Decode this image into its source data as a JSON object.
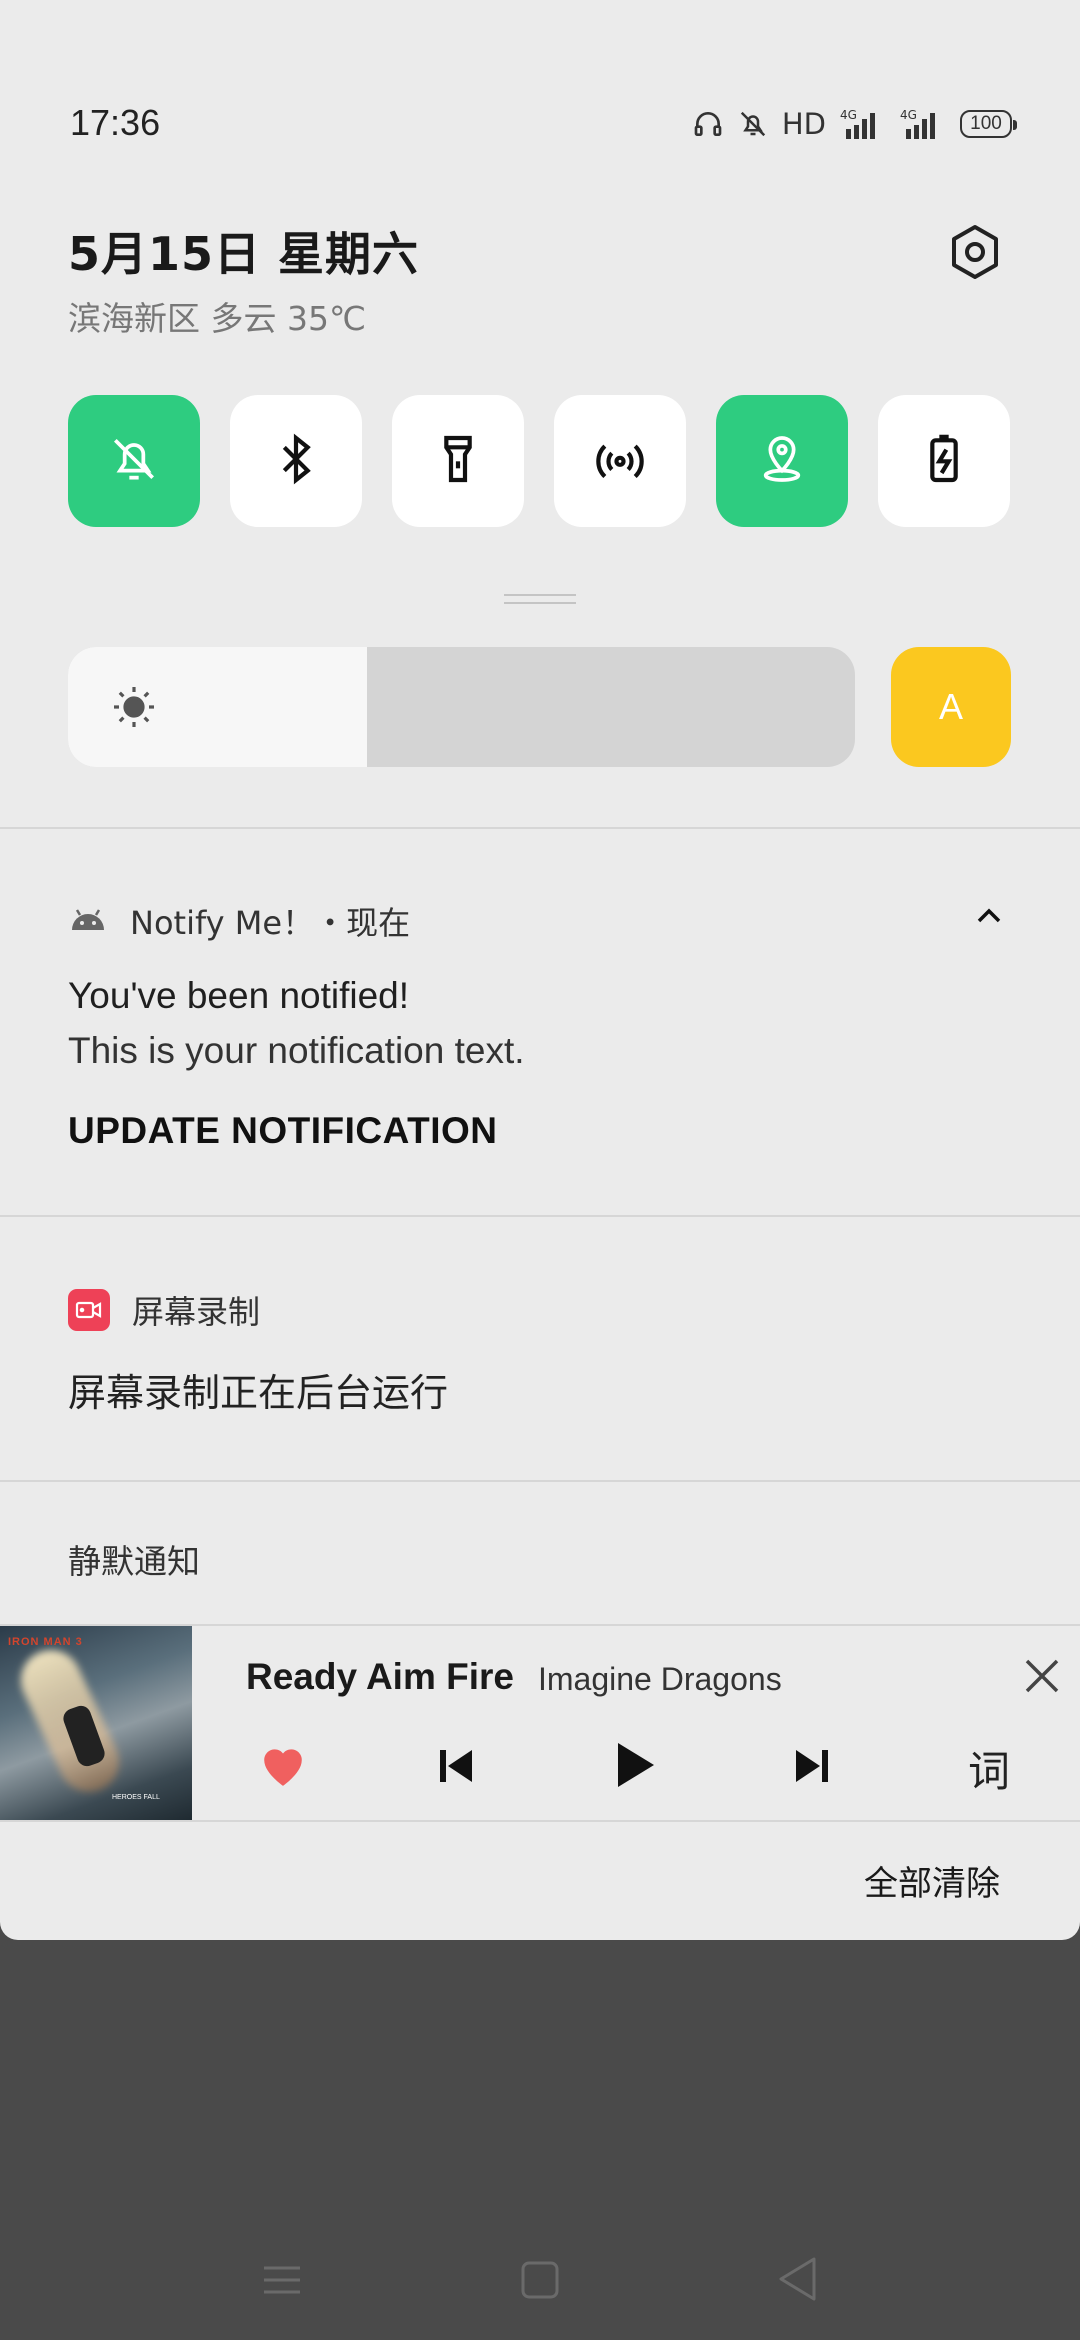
{
  "status_bar": {
    "time": "17:36",
    "network_label": "HD",
    "signal_1": "4G",
    "signal_2": "4G",
    "battery": "100"
  },
  "header": {
    "date": "5月15日  星期六",
    "weather": "滨海新区 多云 35℃"
  },
  "quick_settings": [
    {
      "name": "silent-toggle",
      "icon": "bell-off-icon",
      "active": true
    },
    {
      "name": "bluetooth-toggle",
      "icon": "bluetooth-icon",
      "active": false
    },
    {
      "name": "flashlight-toggle",
      "icon": "flashlight-icon",
      "active": false
    },
    {
      "name": "hotspot-toggle",
      "icon": "hotspot-icon",
      "active": false
    },
    {
      "name": "location-toggle",
      "icon": "location-icon",
      "active": true
    },
    {
      "name": "battery-saver-toggle",
      "icon": "battery-charging-icon",
      "active": false
    }
  ],
  "brightness": {
    "level": 0.38,
    "auto_label": "A"
  },
  "notification_1": {
    "app": "Notify Me！・现在",
    "title": "You've been notified!",
    "text": "This is your notification text.",
    "action": "UPDATE NOTIFICATION"
  },
  "notification_2": {
    "app": "屏幕录制",
    "text": "屏幕录制正在后台运行"
  },
  "silent_section": {
    "label": "静默通知"
  },
  "media": {
    "song": "Ready Aim Fire",
    "artist": "Imagine Dragons",
    "lyrics_label": "词",
    "cover_text": "IRON MAN 3",
    "cover_subtext": "HEROES FALL"
  },
  "footer": {
    "clear_all": "全部清除"
  },
  "colors": {
    "accent_green": "#2ecc80",
    "auto_yellow": "#fbc81f",
    "heart_red": "#f0605f",
    "record_red": "#ee4157"
  }
}
